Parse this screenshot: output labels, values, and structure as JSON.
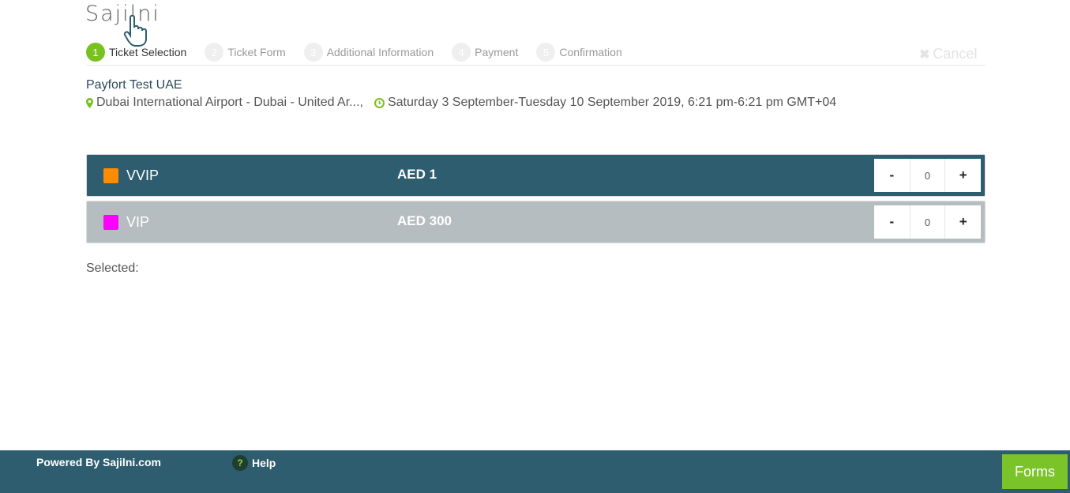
{
  "logo": {
    "text": "Sajilni"
  },
  "steps": [
    {
      "num": "1",
      "label": "Ticket Selection"
    },
    {
      "num": "2",
      "label": "Ticket Form"
    },
    {
      "num": "3",
      "label": "Additional Information"
    },
    {
      "num": "4",
      "label": "Payment"
    },
    {
      "num": "5",
      "label": "Confirmation"
    }
  ],
  "active_step": "1",
  "cancel_label": "Cancel",
  "event": {
    "title": "Payfort Test UAE",
    "location": "Dubai International Airport - Dubai - United Ar...,",
    "date": "Saturday 3 September-Tuesday 10 September 2019, 6:21 pm-6:21 pm GMT+04"
  },
  "tickets": [
    {
      "name": "VVIP",
      "price": "AED 1",
      "color": "#ff8c00",
      "qty": "0",
      "minus": "-",
      "plus": "+"
    },
    {
      "name": "VIP",
      "price": "AED 300",
      "color": "#ff00ff",
      "qty": "0",
      "minus": "-",
      "plus": "+"
    }
  ],
  "selected_label": "Selected:",
  "footer": {
    "powered": "Powered By Sajilni.com",
    "help_icon": "?",
    "help": "Help",
    "forms": "Forms"
  },
  "colors": {
    "accent": "#78c21f",
    "primary": "#2d5d6e"
  }
}
